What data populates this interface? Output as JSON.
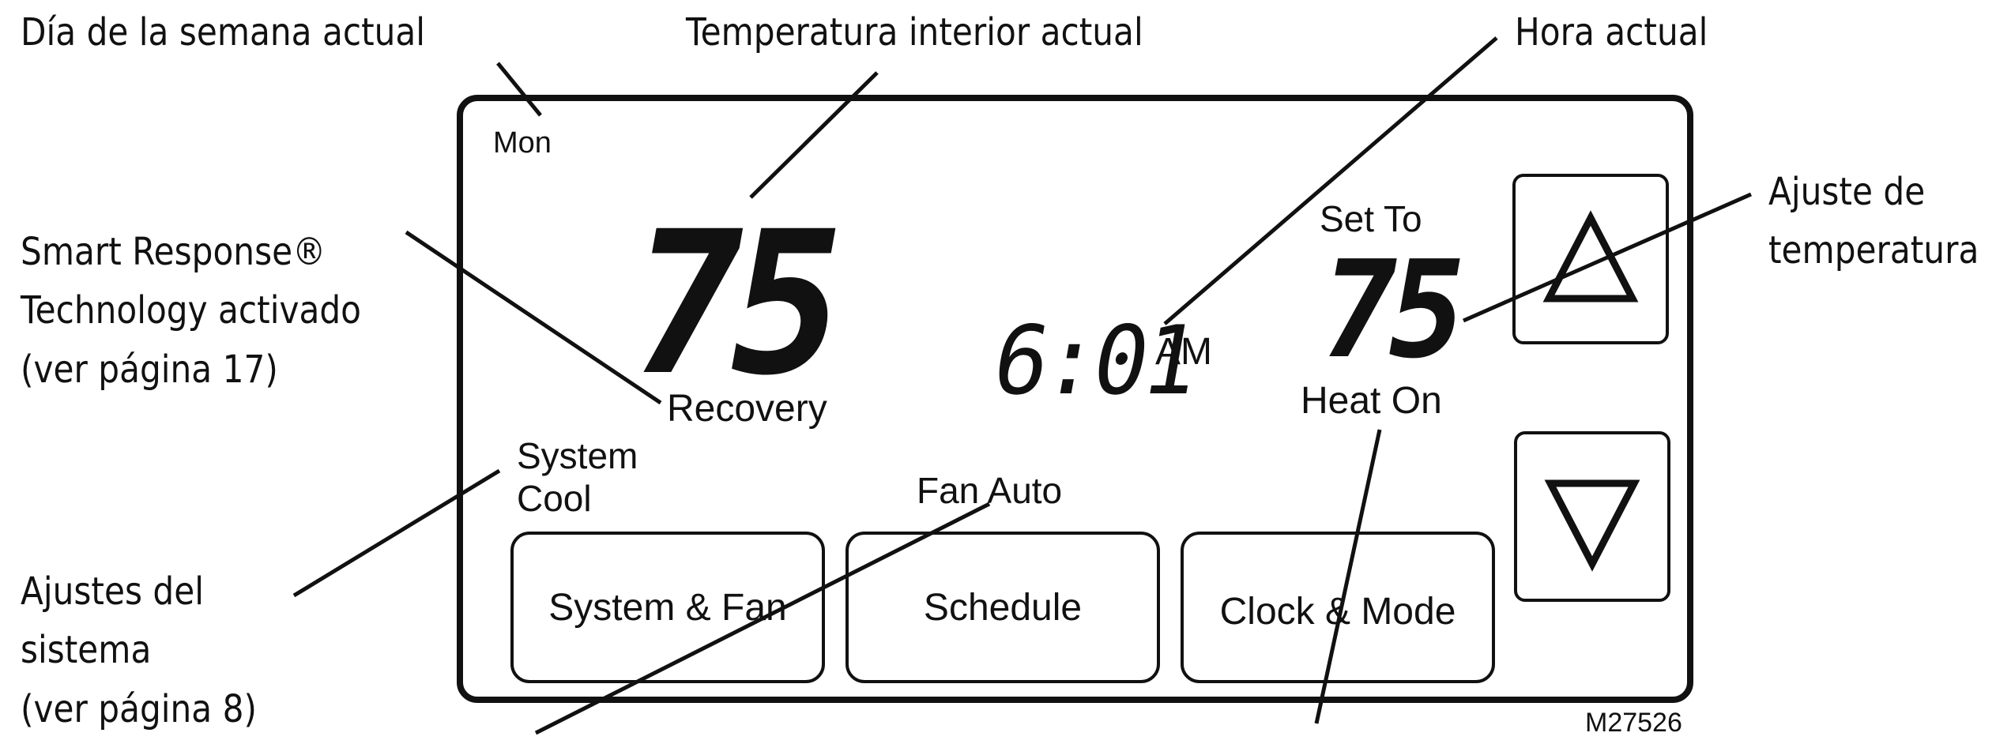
{
  "callouts": {
    "day": "Día de la semana actual",
    "indoor_temp": "Temperatura interior actual",
    "current_time": "Hora actual",
    "temp_setting": [
      "Ajuste de",
      "temperatura"
    ],
    "smart_response": [
      "Smart Response®",
      "Technology activado",
      "(ver página 17)"
    ],
    "system_settings": [
      "Ajustes del",
      "sistema",
      "(ver página 8)"
    ]
  },
  "display": {
    "day": "Mon",
    "indoor_temp": "75",
    "recovery": "Recovery",
    "system_label": "System",
    "system_mode": "Cool",
    "time": "6:01",
    "ampm": "AM",
    "set_to": "Set To",
    "set_temp": "75",
    "heat_status": "Heat On",
    "fan_status": "Fan Auto"
  },
  "buttons": {
    "system_fan": "System & Fan",
    "schedule": "Schedule",
    "clock_mode": "Clock & Mode"
  },
  "icons": {
    "up": "triangle-up-icon",
    "down": "triangle-down-icon"
  },
  "figure_code": "M27526"
}
